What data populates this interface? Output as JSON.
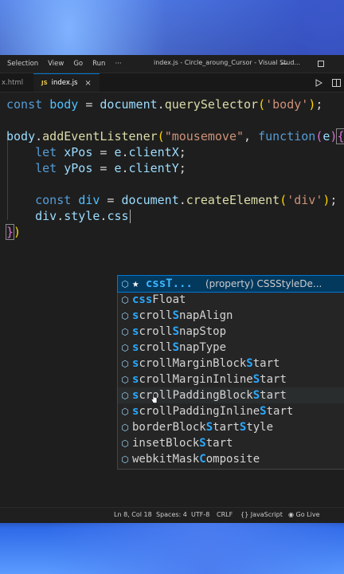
{
  "titlebar": {
    "menus": [
      "Selection",
      "View",
      "Go",
      "Run",
      "···"
    ],
    "title": "index.js - Circle_aroung_Cursor - Visual Stud..."
  },
  "tabs": [
    {
      "label": "x.html",
      "active": false
    },
    {
      "label": "index.js",
      "badge": "JS",
      "active": true,
      "close": "×"
    }
  ],
  "editor": {
    "lines": [
      "const body = document.querySelector('body');",
      "",
      "body.addEventListener(\"mousemove\", function(e){",
      "    let xPos = e.clientX;",
      "    let yPos = e.clientY;",
      "",
      "    const div = document.createElement('div');",
      "    div.style.css",
      "})"
    ]
  },
  "suggest": {
    "items": [
      {
        "label": "cssT...",
        "star": true,
        "detail": "(property) CSSStyleDe..."
      },
      {
        "label": "cssFloat"
      },
      {
        "label": "scrollSnapAlign"
      },
      {
        "label": "scrollSnapStop"
      },
      {
        "label": "scrollSnapType"
      },
      {
        "label": "scrollMarginBlockStart"
      },
      {
        "label": "scrollMarginInlineStart"
      },
      {
        "label": "scrollPaddingBlockStart"
      },
      {
        "label": "scrollPaddingInlineStart"
      },
      {
        "label": "borderBlockStartStyle"
      },
      {
        "label": "insetBlockStart"
      },
      {
        "label": "webkitMaskComposite"
      }
    ]
  },
  "statusbar": {
    "position": "Ln 8, Col 18",
    "spaces": "Spaces: 4",
    "encoding": "UTF-8",
    "eol": "CRLF",
    "language": "JavaScript",
    "golive": "Go Live"
  },
  "colors": {
    "accent": "#0078d4",
    "keyword": "#569cd6",
    "variable": "#9cdcfe",
    "function": "#dcdcaa",
    "string": "#ce9178",
    "match_highlight": "#2aaaff"
  }
}
